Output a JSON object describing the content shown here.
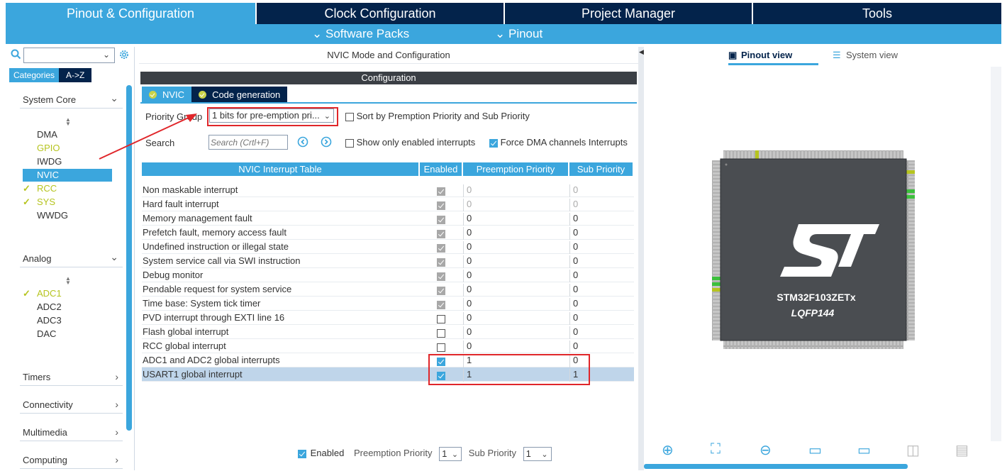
{
  "top_tabs": [
    {
      "label": "Pinout & Configuration",
      "active": true
    },
    {
      "label": "Clock Configuration",
      "active": false
    },
    {
      "label": "Project Manager",
      "active": false
    },
    {
      "label": "Tools",
      "active": false
    }
  ],
  "sub_menu": {
    "software_packs": "Software Packs",
    "pinout": "Pinout"
  },
  "sidebar": {
    "search_value": "",
    "tabs": [
      "Categories",
      "A->Z"
    ],
    "system_core": {
      "title": "System Core",
      "items": [
        {
          "label": "DMA",
          "state": "normal"
        },
        {
          "label": "GPIO",
          "state": "warn"
        },
        {
          "label": "IWDG",
          "state": "normal"
        },
        {
          "label": "NVIC",
          "state": "selected"
        },
        {
          "label": "RCC",
          "state": "ok"
        },
        {
          "label": "SYS",
          "state": "ok"
        },
        {
          "label": "WWDG",
          "state": "normal"
        }
      ]
    },
    "analog": {
      "title": "Analog",
      "items": [
        {
          "label": "ADC1",
          "state": "ok"
        },
        {
          "label": "ADC2",
          "state": "normal"
        },
        {
          "label": "ADC3",
          "state": "normal"
        },
        {
          "label": "DAC",
          "state": "normal"
        }
      ]
    },
    "collapsed": [
      "Timers",
      "Connectivity",
      "Multimedia",
      "Computing"
    ]
  },
  "center": {
    "title": "NVIC Mode and Configuration",
    "config_label": "Configuration",
    "tabs": [
      "NVIC",
      "Code generation"
    ],
    "priority_group_label": "Priority Group",
    "priority_group_value": "1 bits for pre-emption pri...",
    "sort_label": "Sort by Premption Priority and Sub Priority",
    "search_label": "Search",
    "search_placeholder": "Search (Crtl+F)",
    "show_enabled_label": "Show only enabled interrupts",
    "force_dma_label": "Force DMA channels Interrupts",
    "table_headers": [
      "NVIC Interrupt Table",
      "Enabled",
      "Preemption Priority",
      "Sub Priority"
    ],
    "rows": [
      {
        "name": "Non maskable interrupt",
        "enabled": "locked",
        "pre": "0",
        "sub": "0",
        "dim": true
      },
      {
        "name": "Hard fault interrupt",
        "enabled": "locked",
        "pre": "0",
        "sub": "0",
        "dim": true
      },
      {
        "name": "Memory management fault",
        "enabled": "locked",
        "pre": "0",
        "sub": "0",
        "dim": false
      },
      {
        "name": "Prefetch fault, memory access fault",
        "enabled": "locked",
        "pre": "0",
        "sub": "0",
        "dim": false
      },
      {
        "name": "Undefined instruction or illegal state",
        "enabled": "locked",
        "pre": "0",
        "sub": "0",
        "dim": false
      },
      {
        "name": "System service call via SWI instruction",
        "enabled": "locked",
        "pre": "0",
        "sub": "0",
        "dim": false
      },
      {
        "name": "Debug monitor",
        "enabled": "locked",
        "pre": "0",
        "sub": "0",
        "dim": false
      },
      {
        "name": "Pendable request for system service",
        "enabled": "locked",
        "pre": "0",
        "sub": "0",
        "dim": false
      },
      {
        "name": "Time base: System tick timer",
        "enabled": "locked",
        "pre": "0",
        "sub": "0",
        "dim": false
      },
      {
        "name": "PVD interrupt through EXTI line 16",
        "enabled": "off",
        "pre": "0",
        "sub": "0",
        "dim": false
      },
      {
        "name": "Flash global interrupt",
        "enabled": "off",
        "pre": "0",
        "sub": "0",
        "dim": false
      },
      {
        "name": "RCC global interrupt",
        "enabled": "off",
        "pre": "0",
        "sub": "0",
        "dim": false
      },
      {
        "name": "ADC1 and ADC2 global interrupts",
        "enabled": "on",
        "pre": "1",
        "sub": "0",
        "dim": false
      },
      {
        "name": "USART1 global interrupt",
        "enabled": "on",
        "pre": "1",
        "sub": "1",
        "dim": false,
        "selected": true
      }
    ],
    "bottom": {
      "enabled_label": "Enabled",
      "pre_label": "Preemption Priority",
      "pre_value": "1",
      "sub_label": "Sub Priority",
      "sub_value": "1"
    }
  },
  "right": {
    "tabs": [
      "Pinout view",
      "System view"
    ],
    "chip_name": "STM32F103ZETx",
    "chip_package": "LQFP144"
  },
  "colors": {
    "accent": "#3ba6dd",
    "dark": "#03234b",
    "ok": "#b6c41f",
    "highlight": "#e0262a"
  }
}
